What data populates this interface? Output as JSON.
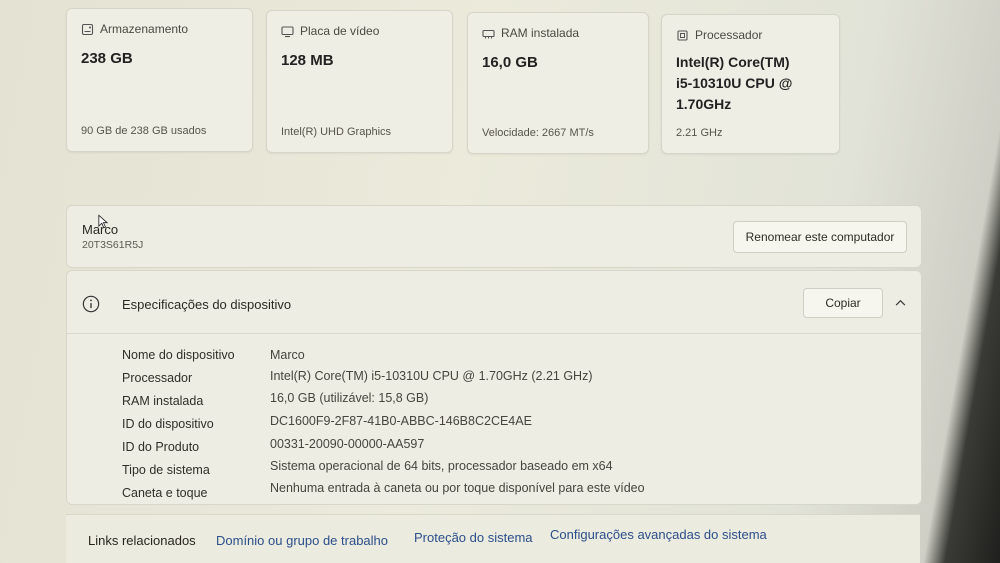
{
  "cards": [
    {
      "title": "Armazenamento",
      "value": "238 GB",
      "sub": "90 GB de 238 GB usados",
      "icon": "storage-icon"
    },
    {
      "title": "Placa de vídeo",
      "value": "128 MB",
      "sub": "Intel(R) UHD Graphics",
      "icon": "display-icon"
    },
    {
      "title": "RAM instalada",
      "value": "16,0 GB",
      "sub": "Velocidade: 2667 MT/s",
      "icon": "memory-icon"
    },
    {
      "title": "Processador",
      "value_lines": [
        "Intel(R) Core(TM)",
        "i5-10310U CPU @",
        "1.70GHz"
      ],
      "sub": "2.21 GHz",
      "icon": "processor-icon"
    }
  ],
  "computer": {
    "name": "Marco",
    "model": "20T3S61R5J",
    "rename_label": "Renomear este computador"
  },
  "specs": {
    "title": "Especificações do dispositivo",
    "copy_label": "Copiar",
    "rows": [
      {
        "label": "Nome do dispositivo",
        "value": "Marco"
      },
      {
        "label": "Processador",
        "value": "Intel(R) Core(TM) i5-10310U CPU @ 1.70GHz (2.21 GHz)"
      },
      {
        "label": "RAM instalada",
        "value": "16,0 GB (utilizável: 15,8 GB)"
      },
      {
        "label": "ID do dispositivo",
        "value": "DC1600F9-2F87-41B0-ABBC-146B8C2CE4AE"
      },
      {
        "label": "ID do Produto",
        "value": "00331-20090-00000-AA597"
      },
      {
        "label": "Tipo de sistema",
        "value": "Sistema operacional de 64 bits, processador baseado em x64"
      },
      {
        "label": "Caneta e toque",
        "value": "Nenhuma entrada à caneta ou por toque disponível para este vídeo"
      }
    ]
  },
  "related": {
    "title": "Links relacionados",
    "links": [
      "Domínio ou grupo de trabalho",
      "Proteção do sistema",
      "Configurações avançadas do sistema"
    ]
  }
}
